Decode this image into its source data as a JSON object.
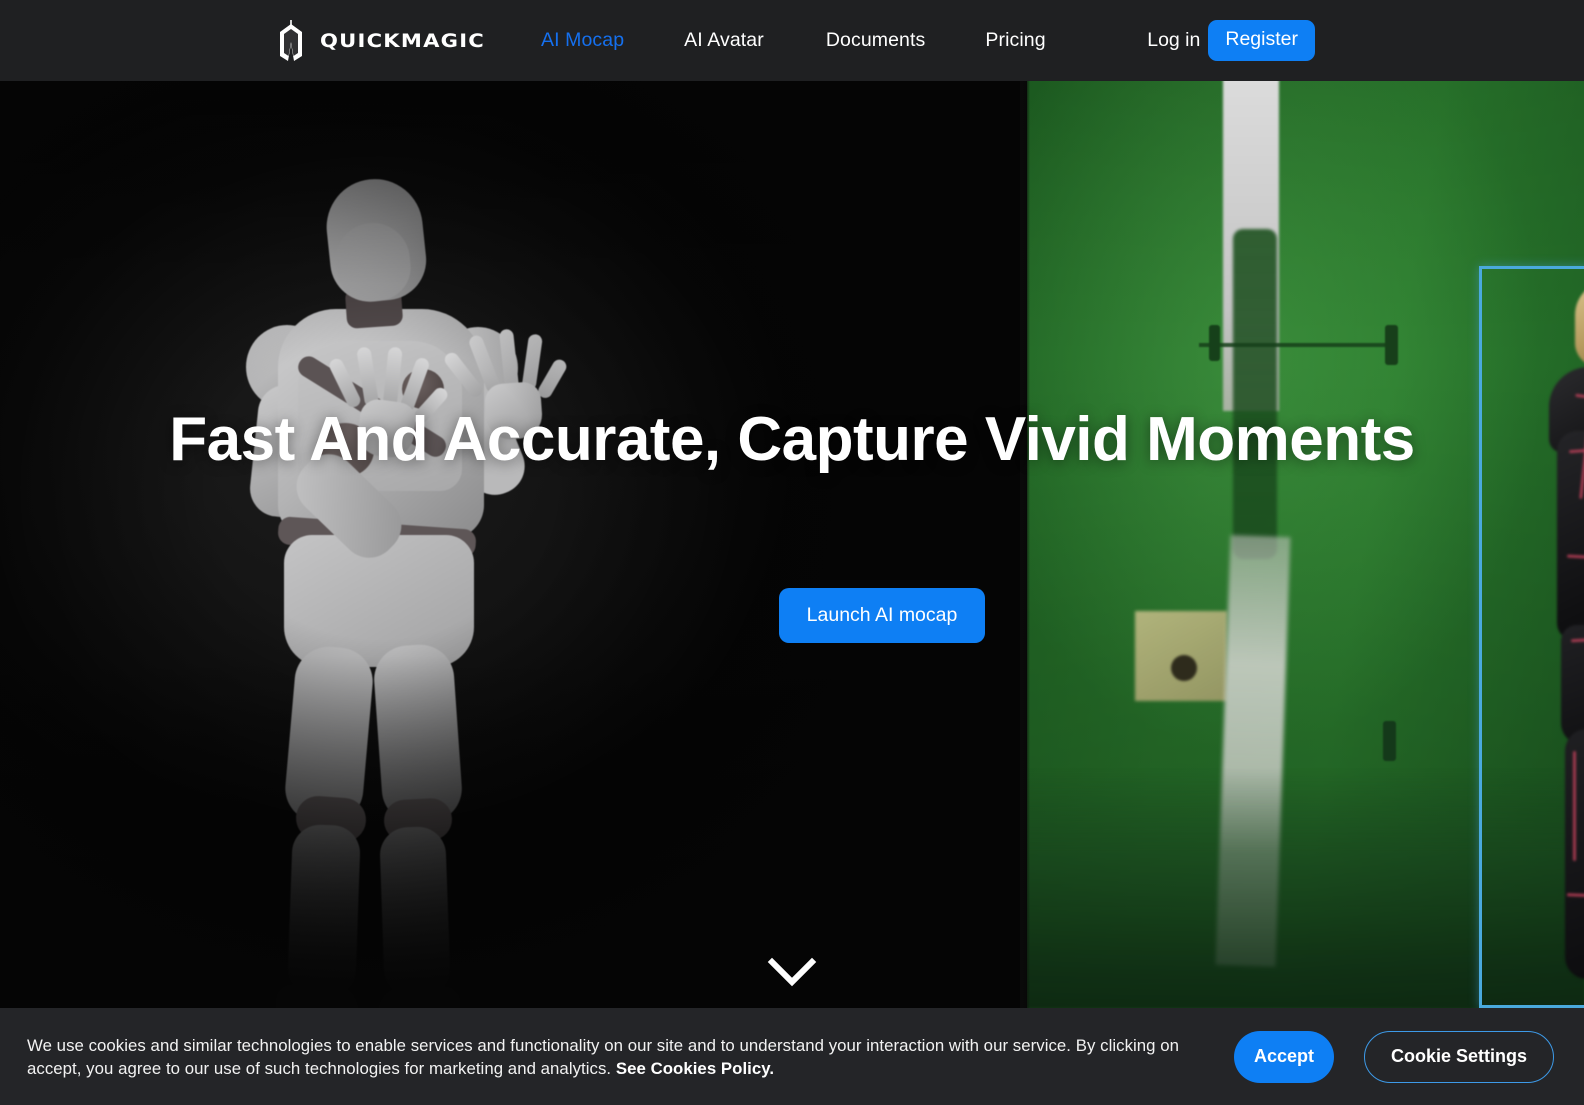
{
  "header": {
    "brand": {
      "name": "QUICKMAGIC",
      "logo_icon": "quickmagic-m-logo-icon"
    },
    "nav": [
      {
        "label": "AI Mocap",
        "active": true
      },
      {
        "label": "AI Avatar",
        "active": false
      },
      {
        "label": "Documents",
        "active": false
      },
      {
        "label": "Pricing",
        "active": false
      }
    ],
    "login_label": "Log in",
    "register_label": "Register",
    "background_color": "#1f2022",
    "accent_color": "#0e7ff4",
    "active_nav_color": "#1570ef"
  },
  "hero": {
    "title": "Fast And Accurate, Capture Vivid Moments",
    "cta_label": "Launch AI mocap",
    "scroll_icon": "chevron-down-icon",
    "left_media": {
      "description": "grey 3D mannequin avatar with raised hands on black background",
      "background_color": "#0a0a0a"
    },
    "right_media": {
      "description": "green screen studio footage of a performer in a dark mocap suit inside a blue detection bounding box",
      "background_color": "#28752b",
      "bbox_color": "#4aa9dd"
    }
  },
  "cookie_banner": {
    "text_before_link": "We use cookies and similar technologies to enable services and functionality on our site and to understand your interaction with our service. By clicking on accept, you agree to our use of such technologies for marketing and analytics. ",
    "link_label": "See Cookies Policy.",
    "accept_label": "Accept",
    "settings_label": "Cookie Settings",
    "background_color": "#242528",
    "accept_color": "#0e7ff4",
    "settings_border_color": "#3d9ae8"
  }
}
